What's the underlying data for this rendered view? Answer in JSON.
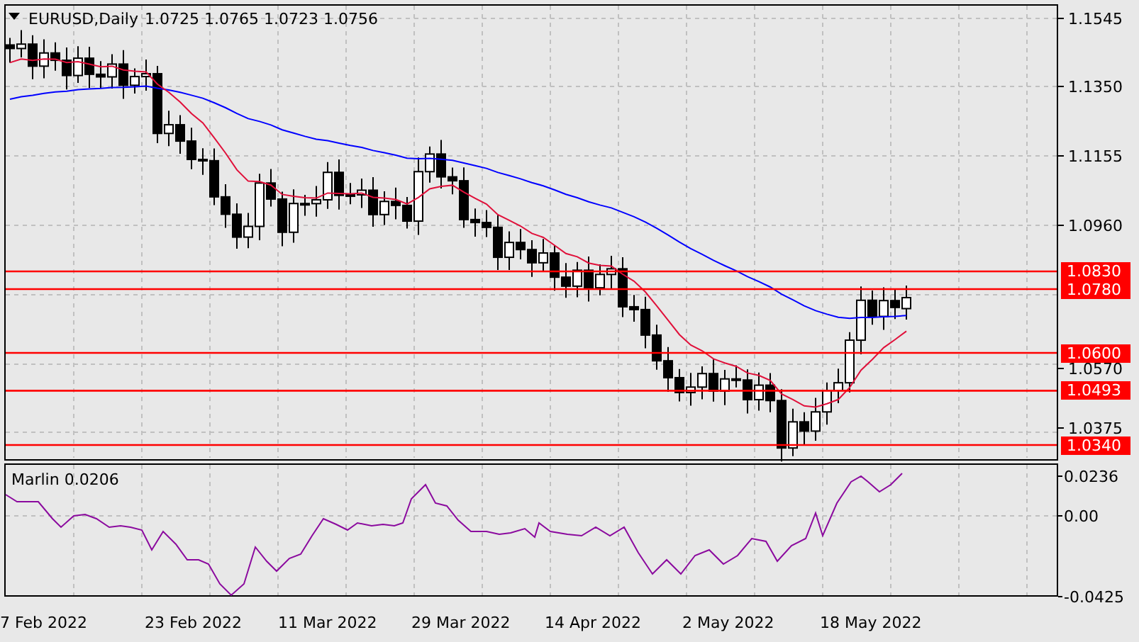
{
  "chart_header": {
    "symbol": "EURUSD,Daily",
    "ohlc": "1.0725 1.0765 1.0723 1.0756"
  },
  "price_axis": {
    "ticks": [
      "1.1545",
      "1.1350",
      "1.1155",
      "1.0960",
      "1.0570",
      "1.0375"
    ]
  },
  "levels": [
    {
      "label": "1.0830"
    },
    {
      "label": "1.0780"
    },
    {
      "label": "1.0600"
    },
    {
      "label": "1.0493"
    },
    {
      "label": "1.0340"
    }
  ],
  "indicator": {
    "name": "Marlin 0.0206",
    "ticks": [
      "0.0236",
      "0.00",
      "-0.0425"
    ]
  },
  "time_axis": {
    "labels": [
      "7 Feb 2022",
      "23 Feb 2022",
      "11 Mar 2022",
      "29 Mar 2022",
      "14 Apr 2022",
      "2 May 2022",
      "18 May 2022"
    ]
  }
}
